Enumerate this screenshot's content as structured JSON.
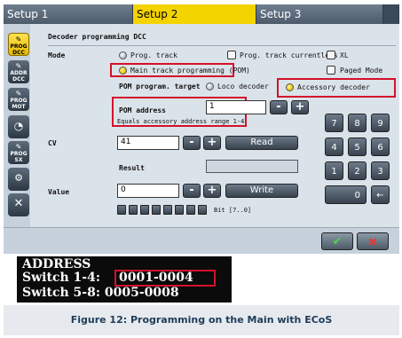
{
  "tabs": [
    {
      "label": "Setup 1"
    },
    {
      "label": "Setup 2"
    },
    {
      "label": "Setup 3"
    }
  ],
  "sidebar": {
    "items": [
      {
        "label": "PROG DCC",
        "active": true
      },
      {
        "label": "ADDR DCC"
      },
      {
        "label": "PROG MOT"
      },
      {
        "label": "gauge"
      },
      {
        "label": "PROG SX"
      },
      {
        "label": "decoder"
      },
      {
        "label": "tools"
      }
    ]
  },
  "form": {
    "title": "Decoder programming DCC",
    "mode_label": "Mode",
    "prog_track": "Prog. track",
    "prog_track_currentless": "Prog. track currentless",
    "xl": "XL",
    "main_track_programming": "Main track programming (POM)",
    "paged_mode": "Paged Mode",
    "pom_target_label": "POM program. target",
    "loco_decoder": "Loco decoder",
    "accessory_decoder": "Accessory decoder",
    "pom_address_label": "POM address",
    "pom_address_value": "1",
    "pom_address_note": "Equals accessory address range 1-4",
    "cv_label": "CV",
    "cv_value": "41",
    "read_label": "Read",
    "result_label": "Result",
    "value_label": "Value",
    "value_value": "0",
    "write_label": "Write",
    "bit_label": "Bit [7..0]",
    "minus": "-",
    "plus": "+"
  },
  "keypad": {
    "keys": [
      "7",
      "8",
      "9",
      "4",
      "5",
      "6",
      "1",
      "2",
      "3",
      "0",
      "←"
    ]
  },
  "footer": {
    "ok": "✔",
    "cancel": "✖"
  },
  "display": {
    "line1": "ADDRESS",
    "line2_label": "Switch 1-4: ",
    "line2_value": "0001-0004",
    "line3": "Switch 5-8: 0005-0008"
  },
  "caption": "Figure 12: Programming on the Main with ECoS",
  "colors": {
    "accent_yellow": "#f4d400",
    "highlight_red": "#d3112b"
  }
}
